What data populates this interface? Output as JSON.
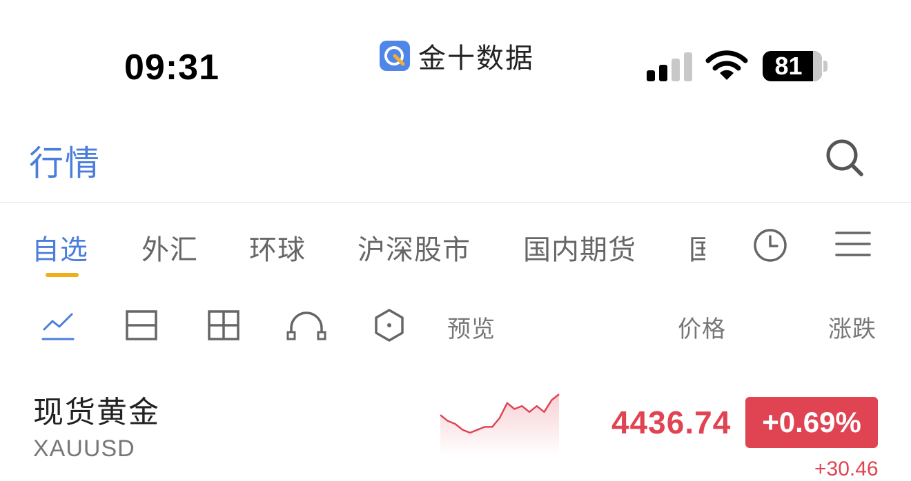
{
  "status_bar": {
    "time": "09:31",
    "app_name": "金十数据",
    "battery": "81"
  },
  "header": {
    "title": "行情"
  },
  "tabs": [
    {
      "label": "自选"
    },
    {
      "label": "外汇"
    },
    {
      "label": "环球"
    },
    {
      "label": "沪深股市"
    },
    {
      "label": "国内期货"
    },
    {
      "label": "国"
    }
  ],
  "list_header": {
    "preview": "预览",
    "price": "价格",
    "change": "涨跌"
  },
  "quotes": [
    {
      "name": "现货黄金",
      "symbol": "XAUUSD",
      "price": "4436.74",
      "change_pct": "+0.69%",
      "change_abs": "+30.46",
      "trend": [
        4436,
        4434,
        4433,
        4431,
        4430,
        4431,
        4432,
        4432,
        4435,
        4440,
        4438,
        4439,
        4437,
        4439,
        4437,
        4441,
        4443
      ]
    }
  ],
  "colors": {
    "accent": "#4a7ddc",
    "tab_indicator": "#f0ae1a",
    "up": "#e04453",
    "app_icon": "#4f86e8"
  },
  "icons": {
    "search": "search-icon",
    "clock": "clock-icon",
    "menu": "menu-icon",
    "views": [
      "line-chart-view-icon",
      "row-view-icon",
      "grid-view-icon",
      "arch-view-icon",
      "hexagon-view-icon"
    ]
  }
}
